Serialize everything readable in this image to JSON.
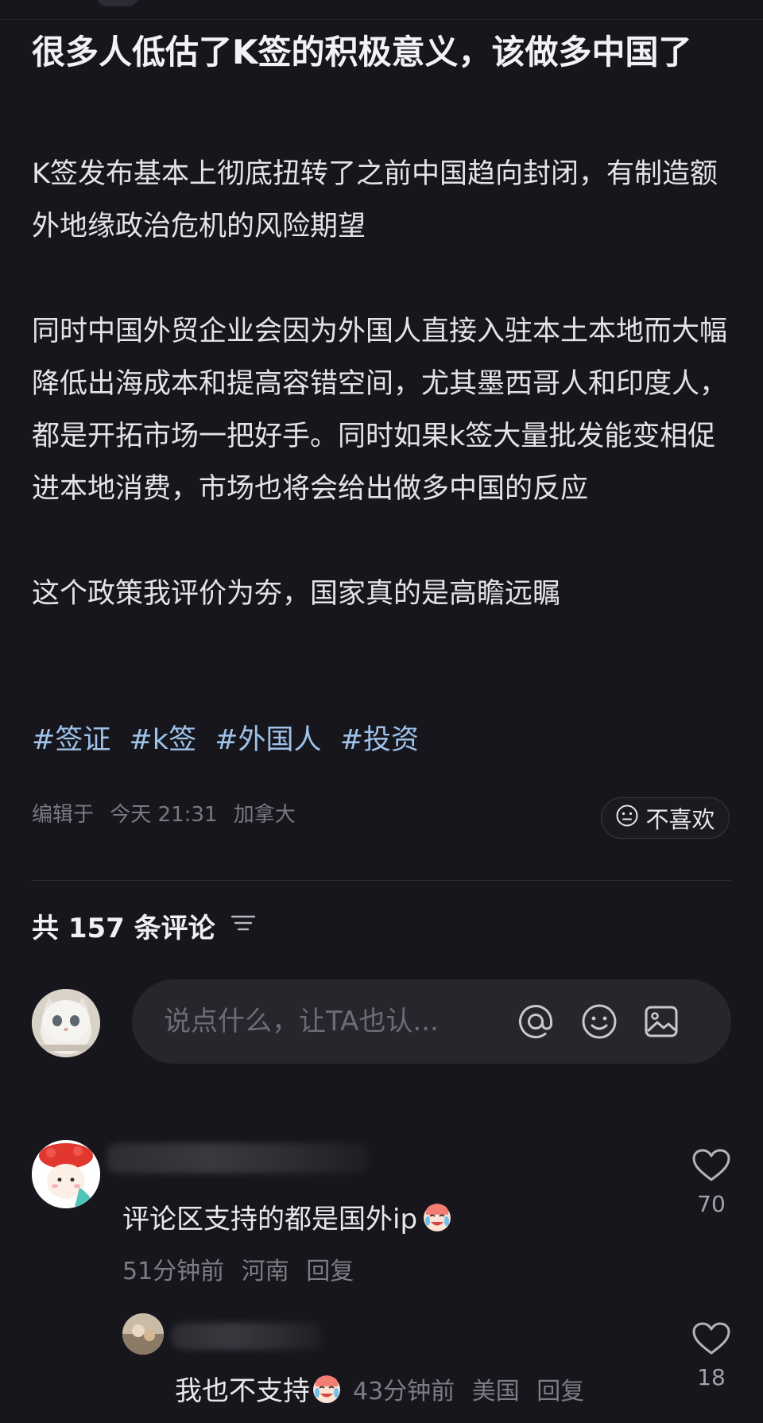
{
  "post": {
    "title": "很多人低估了K签的积极意义，该做多中国了",
    "paragraphs": [
      "K签发布基本上彻底扭转了之前中国趋向封闭，有制造额外地缘政治危机的风险期望",
      "同时中国外贸企业会因为外国人直接入驻本土本地而大幅降低出海成本和提高容错空间，尤其墨西哥人和印度人，都是开拓市场一把好手。同时如果k签大量批发能变相促进本地消费，市场也将会给出做多中国的反应",
      "这个政策我评价为夯，国家真的是高瞻远瞩"
    ],
    "tags": [
      "#签证",
      "#k签",
      "#外国人",
      "#投资"
    ],
    "meta": {
      "edited": "编辑于",
      "time": "今天 21:31",
      "location": "加拿大"
    },
    "dislike_label": "不喜欢"
  },
  "comments_section": {
    "count_label": "共 157 条评论",
    "input_placeholder": "说点什么，让TA也认..."
  },
  "comments": [
    {
      "text": "评论区支持的都是国外ip",
      "time": "51分钟前",
      "location": "河南",
      "reply_label": "回复",
      "likes": "70"
    }
  ],
  "replies": [
    {
      "text": "我也不支持",
      "time": "43分钟前",
      "location": "美国",
      "reply_label": "回复",
      "likes": "18"
    }
  ],
  "icons": {
    "dislike": "sad-face-icon",
    "sort": "sort-lines-icon",
    "mention": "at-icon",
    "emoji": "smiley-icon",
    "image": "image-icon",
    "like": "heart-outline-icon",
    "crying_emoji": "crying-laughing-emoji"
  },
  "colors": {
    "background": "#17161c",
    "tag": "#9ec2ea",
    "meta": "#7a7982"
  }
}
